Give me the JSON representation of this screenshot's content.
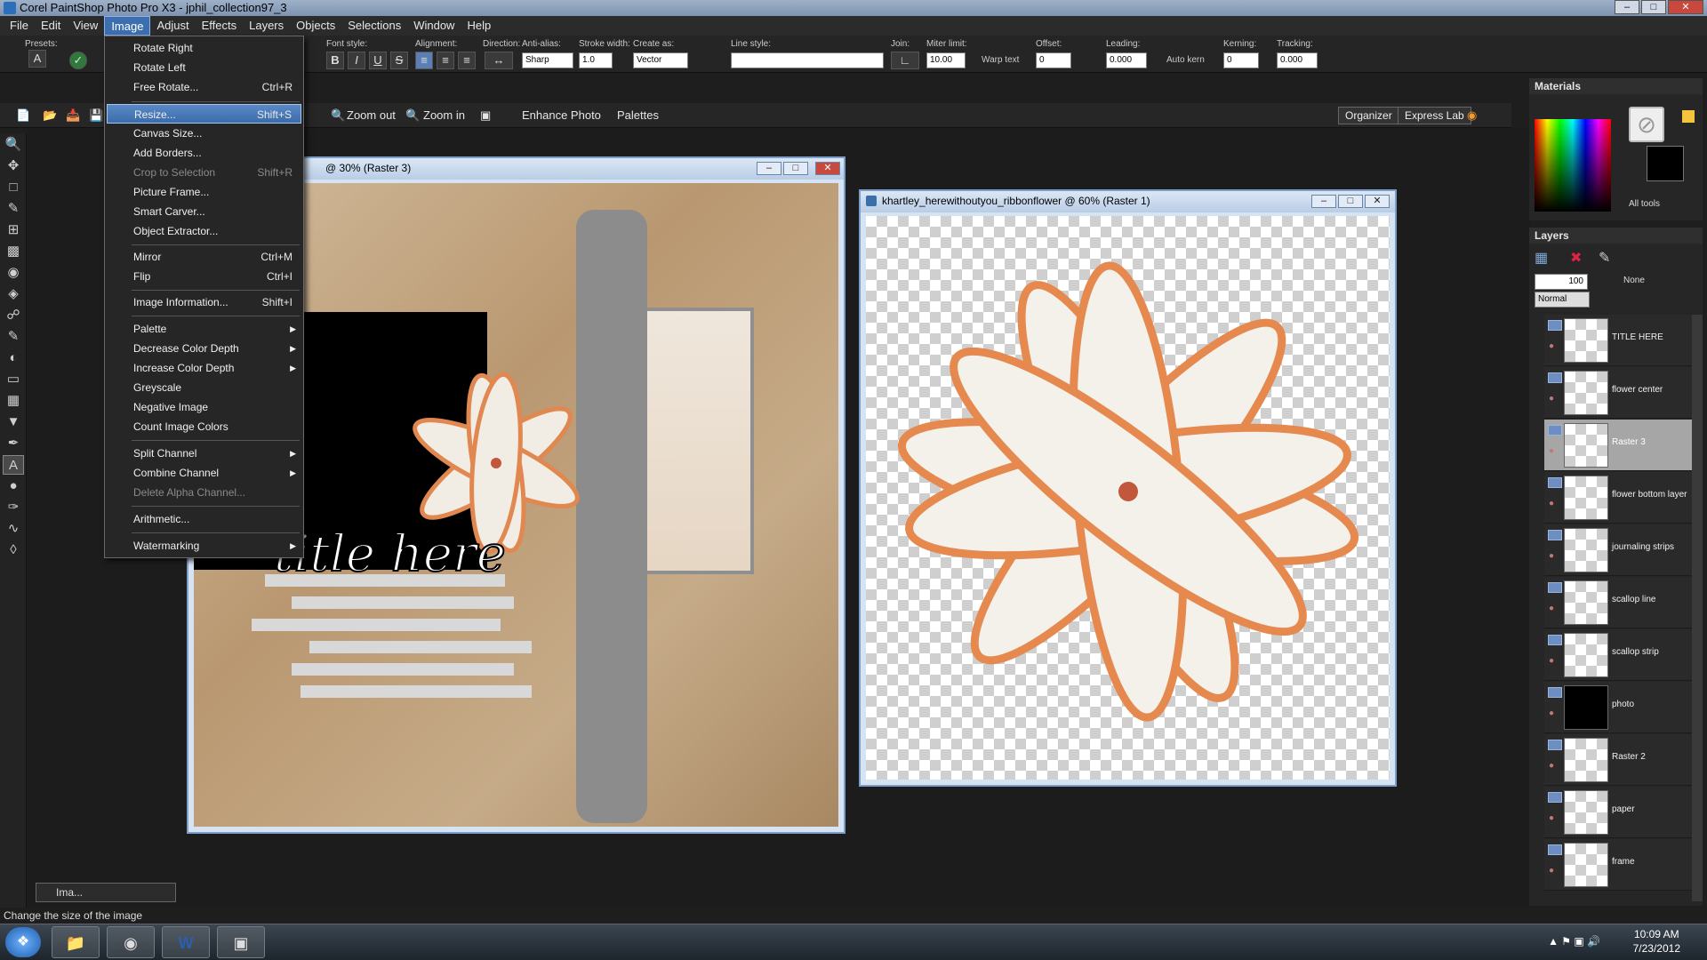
{
  "app": {
    "title": "Corel PaintShop Photo Pro X3 - jphil_collection97_3"
  },
  "menubar": [
    "File",
    "Edit",
    "View",
    "Image",
    "Adjust",
    "Effects",
    "Layers",
    "Objects",
    "Selections",
    "Window",
    "Help"
  ],
  "tool_options": {
    "presets": "Presets:",
    "font_style": "Font style:",
    "alignment": "Alignment:",
    "direction": "Direction:",
    "anti_alias": "Anti-alias:",
    "anti_alias_value": "Sharp",
    "stroke_width": "Stroke width:",
    "stroke_value": "1.0",
    "create_as": "Create as:",
    "create_as_value": "Vector",
    "line_style": "Line style:",
    "join": "Join:",
    "miter_limit": "Miter limit:",
    "miter_value": "10.00",
    "warp_text": "Warp text",
    "offset": "Offset:",
    "offset_value": "0",
    "leading": "Leading:",
    "leading_value": "0.000",
    "auto_kern": "Auto kern",
    "kerning": "Kerning:",
    "kerning_value": "0",
    "tracking": "Tracking:",
    "tracking_value": "0.000"
  },
  "std_toolbar": {
    "zoom_out": "Zoom out",
    "zoom_in": "Zoom in",
    "enhance_photo": "Enhance Photo",
    "palettes": "Palettes",
    "organizer": "Organizer",
    "express_lab": "Express Lab"
  },
  "image_menu": {
    "items": [
      {
        "label": "Rotate Right",
        "shortcut": ""
      },
      {
        "label": "Rotate Left",
        "shortcut": ""
      },
      {
        "label": "Free Rotate...",
        "shortcut": "Ctrl+R"
      },
      {
        "label": "Resize...",
        "shortcut": "Shift+S"
      },
      {
        "label": "Canvas Size...",
        "shortcut": ""
      },
      {
        "label": "Add Borders...",
        "shortcut": ""
      },
      {
        "label": "Crop to Selection",
        "shortcut": "Shift+R"
      },
      {
        "label": "Picture Frame...",
        "shortcut": ""
      },
      {
        "label": "Smart Carver...",
        "shortcut": ""
      },
      {
        "label": "Object Extractor...",
        "shortcut": ""
      },
      {
        "label": "Mirror",
        "shortcut": "Ctrl+M"
      },
      {
        "label": "Flip",
        "shortcut": "Ctrl+I"
      },
      {
        "label": "Image Information...",
        "shortcut": "Shift+I"
      },
      {
        "label": "Palette",
        "shortcut": ""
      },
      {
        "label": "Decrease Color Depth",
        "shortcut": ""
      },
      {
        "label": "Increase Color Depth",
        "shortcut": ""
      },
      {
        "label": "Greyscale",
        "shortcut": ""
      },
      {
        "label": "Negative Image",
        "shortcut": ""
      },
      {
        "label": "Count Image Colors",
        "shortcut": ""
      },
      {
        "label": "Split Channel",
        "shortcut": ""
      },
      {
        "label": "Combine Channel",
        "shortcut": ""
      },
      {
        "label": "Delete Alpha Channel...",
        "shortcut": ""
      },
      {
        "label": "Arithmetic...",
        "shortcut": ""
      },
      {
        "label": "Watermarking",
        "shortcut": ""
      }
    ]
  },
  "doc1": {
    "title": "@ 30% (Raster 3)",
    "title_art": "title here"
  },
  "doc2": {
    "title": "khartley_herewithoutyou_ribbonflower @ 60% (Raster 1)"
  },
  "materials": {
    "title": "Materials",
    "all_tools": "All tools"
  },
  "layers": {
    "title": "Layers",
    "opacity": "100",
    "blend": "Normal",
    "none": "None",
    "items": [
      "TITLE HERE",
      "flower center",
      "Raster 3",
      "flower bottom layer",
      "journaling strips",
      "scallop line",
      "scallop strip",
      "photo",
      "Raster 2",
      "paper",
      "frame"
    ],
    "selected": "Raster 3"
  },
  "minidoc": {
    "label": "Ima..."
  },
  "status": {
    "text": "Change the size of the image"
  },
  "taskbar": {
    "time": "10:09 AM",
    "date": "7/23/2012"
  }
}
